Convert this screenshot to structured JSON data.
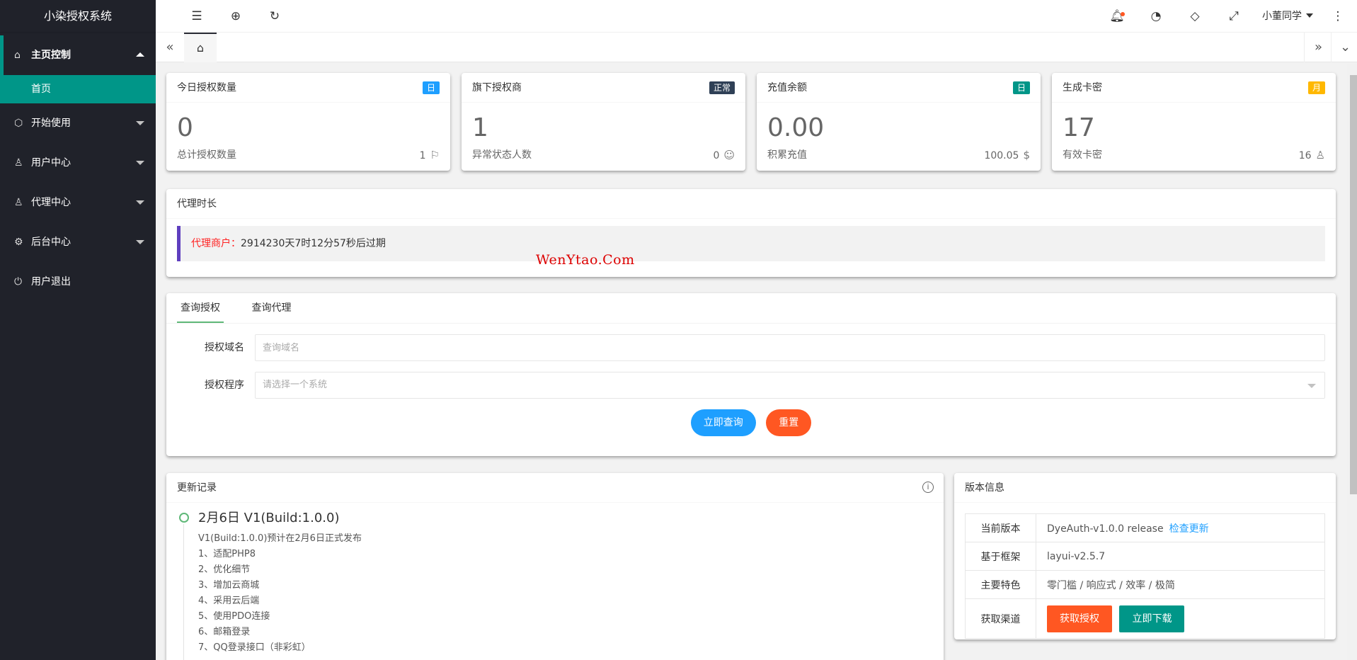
{
  "app": {
    "title": "小染授权系统"
  },
  "sidebar": {
    "items": [
      {
        "label": "主页控制",
        "icon": "home-icon",
        "glyph": "⌂",
        "open": true,
        "sub": [
          {
            "label": "首页"
          }
        ]
      },
      {
        "label": "开始使用",
        "icon": "cube-icon",
        "glyph": "⬡"
      },
      {
        "label": "用户中心",
        "icon": "user-icon",
        "glyph": "♙"
      },
      {
        "label": "代理中心",
        "icon": "agent-icon",
        "glyph": "♙"
      },
      {
        "label": "后台中心",
        "icon": "gear-icon",
        "glyph": "⚙"
      },
      {
        "label": "用户退出",
        "icon": "power-icon",
        "glyph": "⏻"
      }
    ]
  },
  "header": {
    "user_name": "小董同学"
  },
  "stats": [
    {
      "title": "今日授权数量",
      "badge": "日",
      "badge_color": "#1e9fff",
      "value": "0",
      "foot_label": "总计授权数量",
      "foot_value": "1",
      "foot_icon": "flag-icon",
      "foot_glyph": "⚐"
    },
    {
      "title": "旗下授权商",
      "badge": "正常",
      "badge_color": "#2f4056",
      "value": "1",
      "foot_label": "异常状态人数",
      "foot_value": "0",
      "foot_icon": "smile-icon",
      "foot_glyph": "☺"
    },
    {
      "title": "充值余额",
      "badge": "日",
      "badge_color": "#009688",
      "value": "0.00",
      "foot_label": "积累充值",
      "foot_value": "100.05",
      "foot_icon": "dollar-icon",
      "foot_glyph": "$"
    },
    {
      "title": "生成卡密",
      "badge": "月",
      "badge_color": "#ffb800",
      "value": "17",
      "foot_label": "有效卡密",
      "foot_value": "16",
      "foot_icon": "user-icon",
      "foot_glyph": "♙"
    }
  ],
  "agent": {
    "title": "代理时长",
    "notice_label": "代理商户：",
    "notice_text": "2914230天7时12分57秒后过期"
  },
  "watermark": "WenYtao.Com",
  "query": {
    "tabs": [
      "查询授权",
      "查询代理"
    ],
    "domain_label": "授权域名",
    "domain_placeholder": "查询域名",
    "program_label": "授权程序",
    "program_placeholder": "请选择一个系统",
    "submit_label": "立即查询",
    "reset_label": "重置"
  },
  "changelog": {
    "title": "更新记录",
    "entry_title": "2月6日 V1(Build:1.0.0)",
    "lines": [
      "V1(Build:1.0.0)预计在2月6日正式发布",
      "1、适配PHP8",
      "2、优化细节",
      "3、增加云商城",
      "4、采用云后端",
      "5、使用PDO连接",
      "6、邮箱登录",
      "7、QQ登录接口（非彩虹）"
    ]
  },
  "version": {
    "title": "版本信息",
    "current_label": "当前版本",
    "current_value": "DyeAuth-v1.0.0 release",
    "check_update": "检查更新",
    "framework_label": "基于框架",
    "framework_value": "layui-v2.5.7",
    "features_label": "主要特色",
    "features_value": "零门槛 / 响应式 / 效率 / 极简",
    "channel_label": "获取渠道",
    "get_auth": "获取授权",
    "download": "立即下载"
  }
}
